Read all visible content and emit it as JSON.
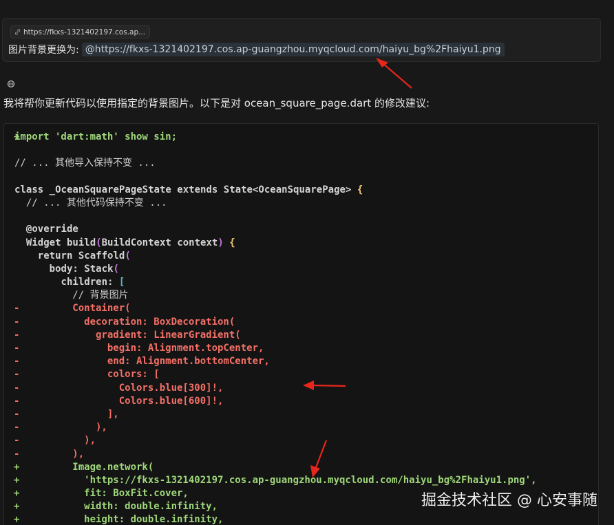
{
  "prompt": {
    "chip_url": "https://fkxs-1321402197.cos.ap...",
    "text": "图片背景更换为:",
    "mention": "@https://fkxs-1321402197.cos.ap-guangzhou.myqcloud.com/haiyu_bg%2Fhaiyu1.png"
  },
  "assistant": {
    "icon": "globe-icon",
    "message": "我将帮你更新代码以使用指定的背景图片。以下是对 ocean_square_page.dart 的修改建议:"
  },
  "code": {
    "lines": [
      {
        "marker": "+",
        "type": "add",
        "text": "import 'dart:math' show sin;"
      },
      {
        "marker": "",
        "type": "blank",
        "text": ""
      },
      {
        "marker": "",
        "type": "comment",
        "text": "// ... 其他导入保持不变 ..."
      },
      {
        "marker": "",
        "type": "blank",
        "text": ""
      },
      {
        "marker": "",
        "type": "class",
        "text": "class _OceanSquarePageState extends State<OceanSquarePage> {"
      },
      {
        "marker": "",
        "type": "comment",
        "text": "  // ... 其他代码保持不变 ..."
      },
      {
        "marker": "",
        "type": "blank",
        "text": ""
      },
      {
        "marker": "",
        "type": "default",
        "text": "  @override"
      },
      {
        "marker": "",
        "type": "build",
        "text": "  Widget build(BuildContext context) {"
      },
      {
        "marker": "",
        "type": "scaffold",
        "text": "    return Scaffold("
      },
      {
        "marker": "",
        "type": "stack",
        "text": "      body: Stack("
      },
      {
        "marker": "",
        "type": "children",
        "text": "        children: ["
      },
      {
        "marker": "",
        "type": "comment",
        "text": "          // 背景图片"
      },
      {
        "marker": "-",
        "type": "del",
        "text": "          Container("
      },
      {
        "marker": "-",
        "type": "del",
        "text": "            decoration: BoxDecoration("
      },
      {
        "marker": "-",
        "type": "del",
        "text": "              gradient: LinearGradient("
      },
      {
        "marker": "-",
        "type": "del",
        "text": "                begin: Alignment.topCenter,"
      },
      {
        "marker": "-",
        "type": "del",
        "text": "                end: Alignment.bottomCenter,"
      },
      {
        "marker": "-",
        "type": "del",
        "text": "                colors: ["
      },
      {
        "marker": "-",
        "type": "del",
        "text": "                  Colors.blue[300]!,"
      },
      {
        "marker": "-",
        "type": "del",
        "text": "                  Colors.blue[600]!,"
      },
      {
        "marker": "-",
        "type": "del",
        "text": "                ],"
      },
      {
        "marker": "-",
        "type": "del",
        "text": "              ),"
      },
      {
        "marker": "-",
        "type": "del",
        "text": "            ),"
      },
      {
        "marker": "-",
        "type": "del",
        "text": "          ),"
      },
      {
        "marker": "+",
        "type": "add",
        "text": "          Image.network("
      },
      {
        "marker": "+",
        "type": "add",
        "text": "            'https://fkxs-1321402197.cos.ap-guangzhou.myqcloud.com/haiyu_bg%2Fhaiyu1.png',"
      },
      {
        "marker": "+",
        "type": "add",
        "text": "            fit: BoxFit.cover,"
      },
      {
        "marker": "+",
        "type": "add",
        "text": "            width: double.infinity,"
      },
      {
        "marker": "+",
        "type": "add",
        "text": "            height: double.infinity,"
      }
    ]
  },
  "watermark": "掘金技术社区 @ 心安事随",
  "colors": {
    "background": "#181818",
    "add": "#9fd77a",
    "del": "#f47067",
    "arrow": "#e8261c"
  }
}
